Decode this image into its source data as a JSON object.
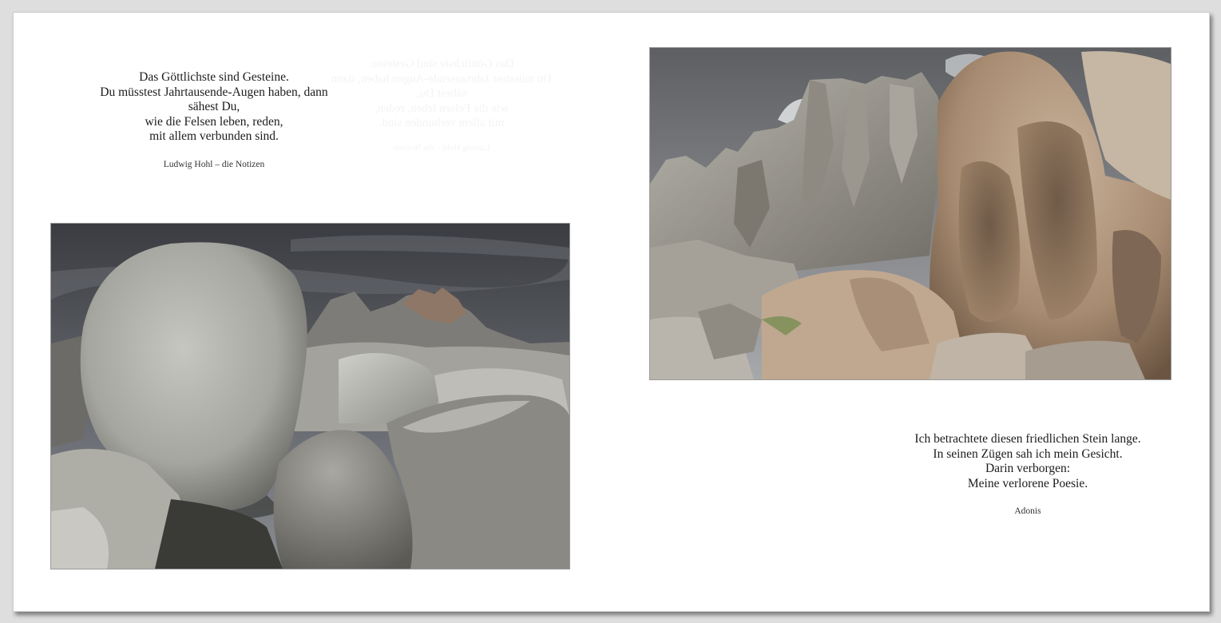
{
  "left_page": {
    "quote": "Das Göttlichste sind Gesteine.\nDu müsstest Jahrtausende-Augen haben, dann\nsähest Du,\nwie die Felsen leben, reden,\nmit allem verbunden sind.",
    "source": "Ludwig Hohl – die Notizen",
    "photo": "granite-boulders-photo"
  },
  "right_page": {
    "quote": "Ich betrachtete diesen friedlichen Stein lange.\nIn seinen Zügen sah ich mein Gesicht.\nDarin verborgen:\nMeine verlorene Poesie.",
    "source": "Adonis",
    "photo": "eroded-rock-face-photo"
  },
  "colors": {
    "page": "#ffffff",
    "background": "#dedede",
    "text": "#1c1c1c"
  }
}
